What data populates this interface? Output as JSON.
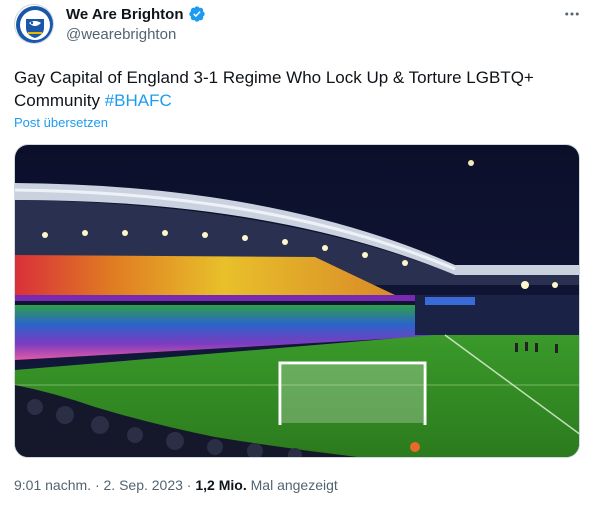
{
  "account": {
    "display_name": "We Are Brighton",
    "handle": "@wearebrighton",
    "avatar_icon": "club-crest-avatar",
    "verified_icon": "verified-badge-icon",
    "verified_color": "#1d9bf0"
  },
  "more_icon": "more-options-icon",
  "tweet": {
    "text": "Gay Capital of England 3-1 Regime Who Lock Up & Torture LGBTQ+ Community ",
    "hashtag": "#BHAFC",
    "translate_label": "Post übersetzen"
  },
  "media": {
    "image_icon": "stadium-photo"
  },
  "meta": {
    "time": "9:01 nachm.",
    "separator": " · ",
    "date": "2. Sep. 2023",
    "views_count": "1,2 Mio.",
    "views_label": " Mal angezeigt"
  },
  "colors": {
    "text_primary": "#0f1419",
    "text_secondary": "#536471",
    "accent": "#1d9bf0"
  }
}
